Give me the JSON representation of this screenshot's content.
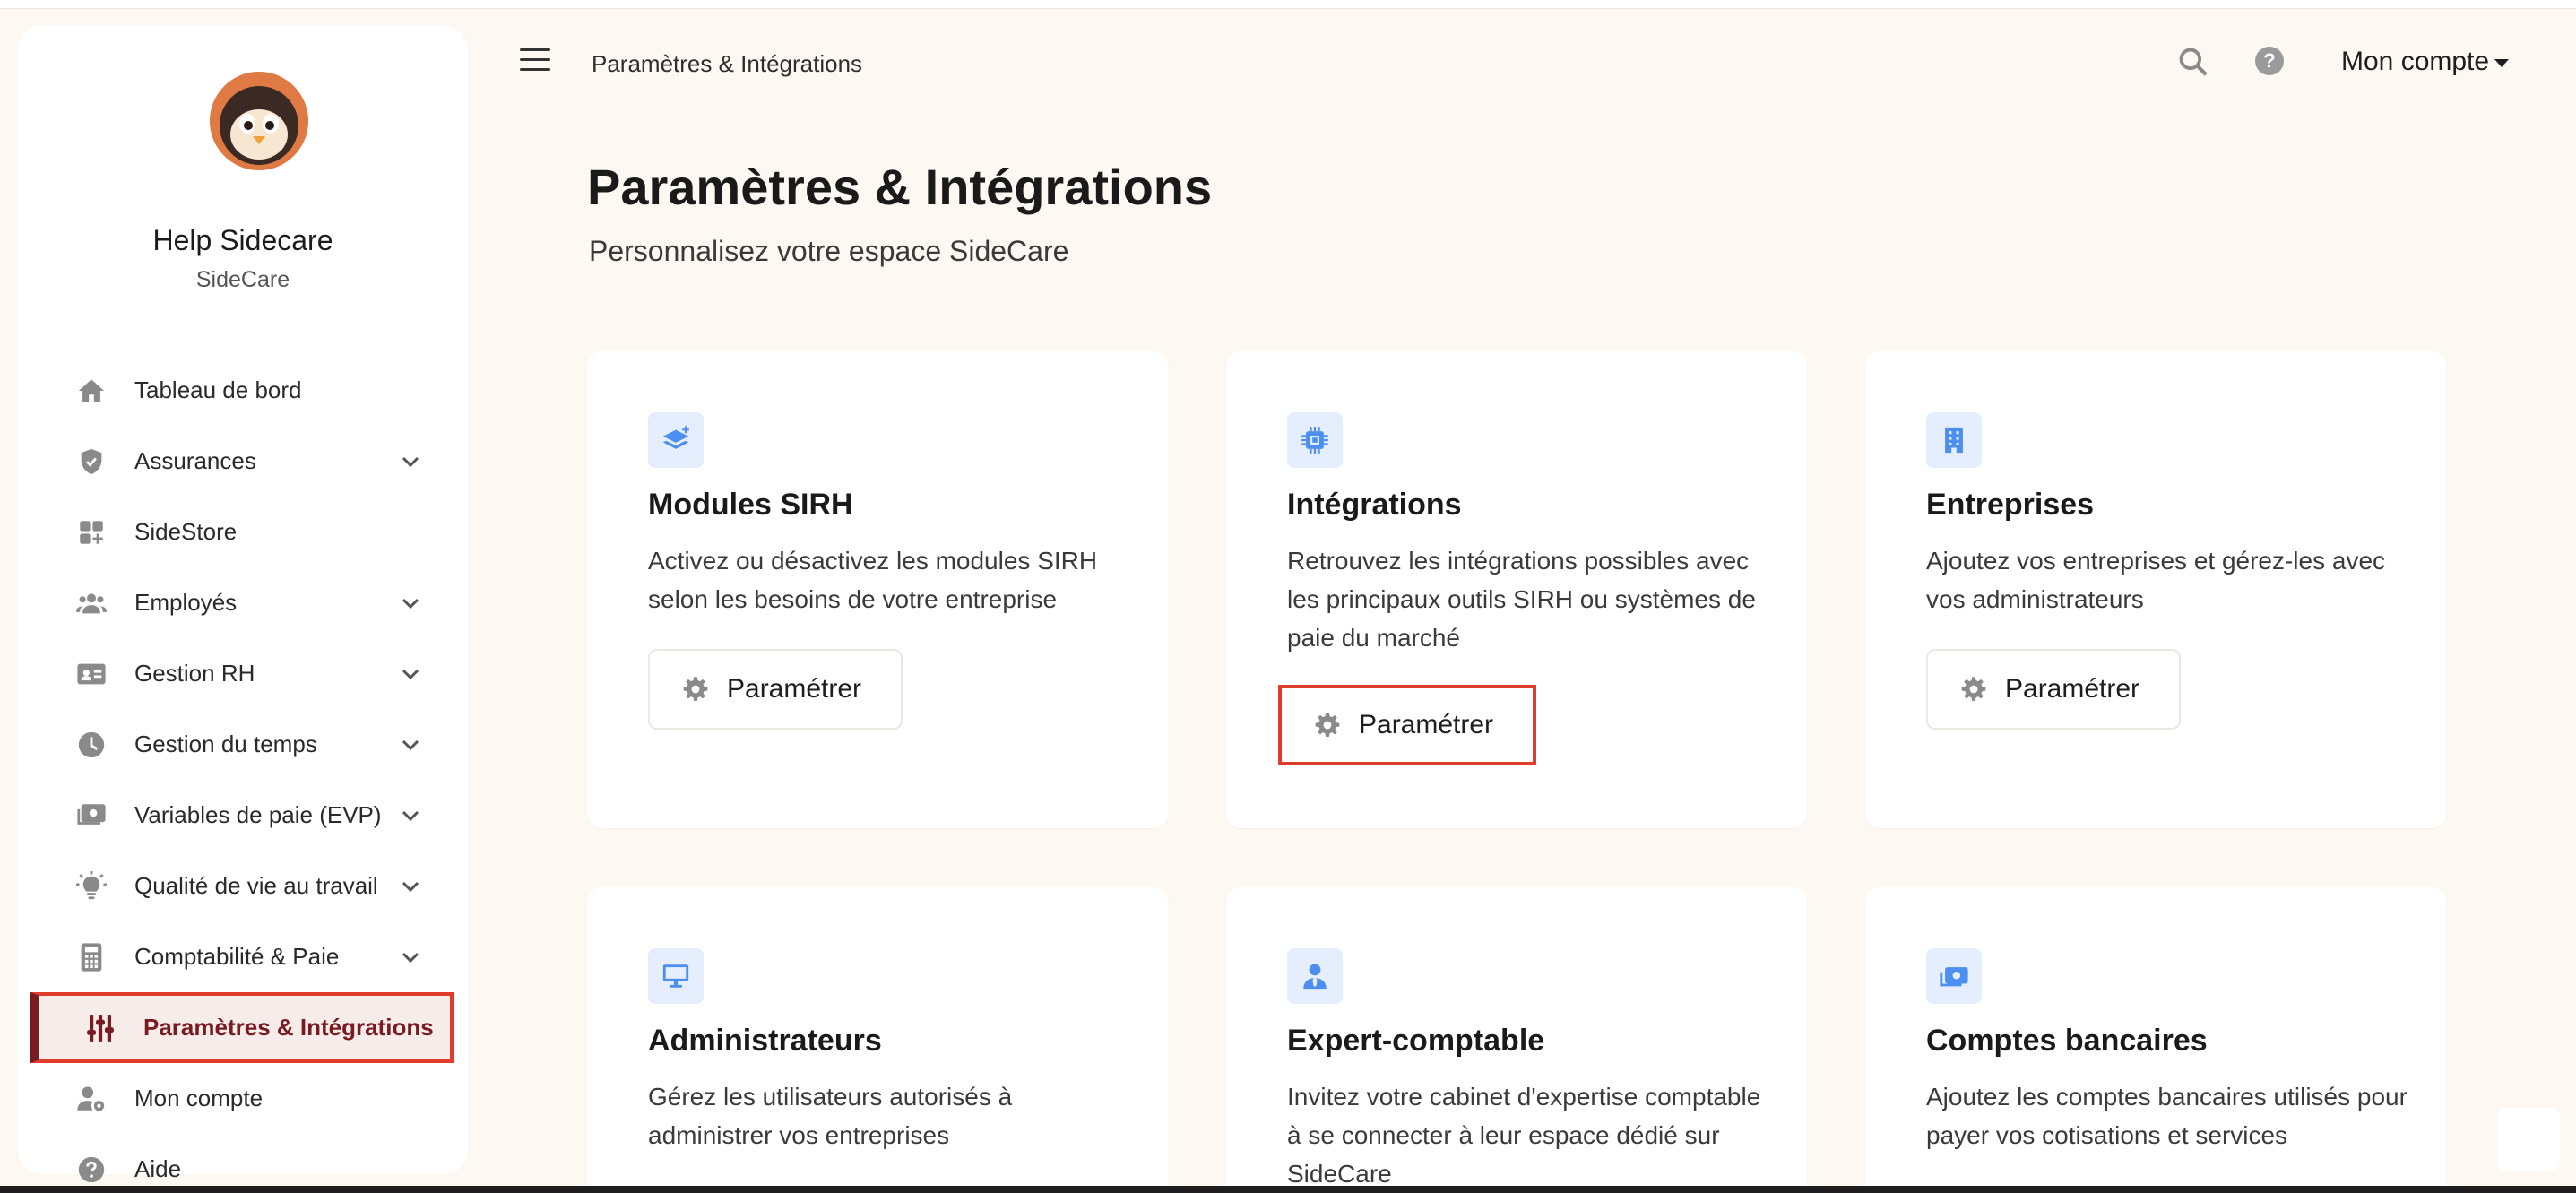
{
  "sidebar": {
    "user_name": "Help Sidecare",
    "user_company": "SideCare",
    "items": [
      {
        "label": "Tableau de bord",
        "icon": "home-icon",
        "chevron": false
      },
      {
        "label": "Assurances",
        "icon": "shield-icon",
        "chevron": true
      },
      {
        "label": "SideStore",
        "icon": "grid-plus-icon",
        "chevron": false
      },
      {
        "label": "Employés",
        "icon": "users-icon",
        "chevron": true
      },
      {
        "label": "Gestion RH",
        "icon": "id-card-icon",
        "chevron": true
      },
      {
        "label": "Gestion du temps",
        "icon": "clock-icon",
        "chevron": true
      },
      {
        "label": "Variables de paie (EVP)",
        "icon": "money-icon",
        "chevron": true
      },
      {
        "label": "Qualité de vie au travail",
        "icon": "lightbulb-icon",
        "chevron": true
      },
      {
        "label": "Comptabilité & Paie",
        "icon": "calculator-icon",
        "chevron": true
      },
      {
        "label": "Paramètres & Intégrations",
        "icon": "sliders-icon",
        "chevron": false,
        "active": true
      },
      {
        "label": "Mon compte",
        "icon": "user-gear-icon",
        "chevron": false
      },
      {
        "label": "Aide",
        "icon": "question-icon",
        "chevron": false
      }
    ]
  },
  "topbar": {
    "breadcrumb": "Paramètres & Intégrations",
    "help_glyph": "?",
    "account_label": "Mon compte"
  },
  "page": {
    "title": "Paramètres & Intégrations",
    "subtitle": "Personnalisez votre espace SideCare"
  },
  "cards": [
    {
      "title": "Modules SIRH",
      "icon": "layers-icon",
      "description": "Activez ou désactivez les modules SIRH selon les besoins de votre entreprise",
      "button": "Paramétrer"
    },
    {
      "title": "Intégrations",
      "icon": "chip-icon",
      "description": "Retrouvez les intégrations possibles avec les principaux outils SIRH ou systèmes de paie du marché",
      "button": "Paramétrer"
    },
    {
      "title": "Entreprises",
      "icon": "building-icon",
      "description": "Ajoutez vos entreprises et gérez-les avec vos administrateurs",
      "button": "Paramétrer"
    },
    {
      "title": "Administrateurs",
      "icon": "monitor-icon",
      "description": "Gérez les utilisateurs autorisés à administrer vos entreprises"
    },
    {
      "title": "Expert-comptable",
      "icon": "user-tie-icon",
      "description": "Invitez votre cabinet d'expertise comptable à se connecter à leur espace dédié sur SideCare"
    },
    {
      "title": "Comptes bancaires",
      "icon": "money-bill-icon",
      "description": "Ajoutez les comptes bancaires utilisés pour payer vos cotisations et services"
    }
  ],
  "colors": {
    "background": "#fdf8f2",
    "accent_dark": "#7a1b22",
    "highlight": "#e03c2a",
    "icon_blue": "#4d8ff0",
    "icon_bg": "#e4eefc"
  }
}
